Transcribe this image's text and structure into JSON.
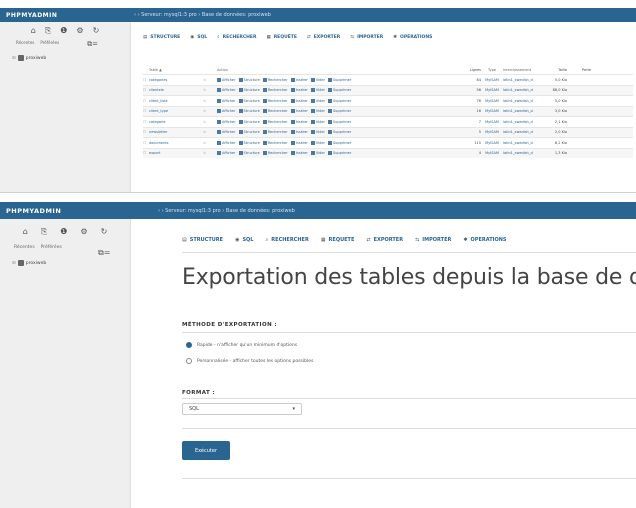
{
  "app": {
    "logo": "PHPMYADMIN"
  },
  "back": {
    "breadcrumb": "‹ › Serveur: mysql1:3 pro › Base de données: proxiweb",
    "nav_icons": [
      "home-icon",
      "logout-icon",
      "info-icon",
      "settings-icon",
      "reload-icon"
    ],
    "sidebar_links": [
      "Récentes",
      "Préférées"
    ],
    "tree_db": "proxiweb",
    "tabs": [
      "STRUCTURE",
      "SQL",
      "RECHERCHER",
      "REQUÊTE",
      "EXPORTER",
      "IMPORTER",
      "OPÉRATIONS"
    ],
    "table_headers": [
      "Table ▲",
      "Action",
      "Lignes",
      "Type",
      "Interclassement",
      "Taille",
      "Perte"
    ],
    "action_labels": [
      "Afficher",
      "Structure",
      "Rechercher",
      "Insérer",
      "Vider",
      "Supprimer"
    ],
    "rows": [
      {
        "name": "categories",
        "lines": "84",
        "type": "MyISAM",
        "coll": "latin1_swedish_ci",
        "size": "5,0 Kio"
      },
      {
        "name": "clientele",
        "lines": "56",
        "type": "MyISAM",
        "coll": "latin1_swedish_ci",
        "size": "88,0 Kio"
      },
      {
        "name": "client_liste",
        "lines": "76",
        "type": "MyISAM",
        "coll": "latin1_swedish_ci",
        "size": "5,0 Kio"
      },
      {
        "name": "client_type",
        "lines": "16",
        "type": "MyISAM",
        "coll": "latin1_swedish_ci",
        "size": "3,0 Kio"
      },
      {
        "name": "categorie",
        "lines": "7",
        "type": "MyISAM",
        "coll": "latin1_swedish_ci",
        "size": "2,1 Kio"
      },
      {
        "name": "newsletter",
        "lines": "5",
        "type": "MyISAM",
        "coll": "latin1_swedish_ci",
        "size": "2,0 Kio"
      },
      {
        "name": "documents",
        "lines": "115",
        "type": "MyISAM",
        "coll": "latin1_swedish_ci",
        "size": "8,2 Kio"
      },
      {
        "name": "export",
        "lines": "4",
        "type": "MyISAM",
        "coll": "latin1_swedish_ci",
        "size": "1,3 Kio"
      }
    ]
  },
  "front": {
    "breadcrumb": "‹ › Serveur: mysql1:3 pro › Base de données: proxiweb",
    "nav_icons": [
      "home-icon",
      "logout-icon",
      "info-icon",
      "settings-icon",
      "reload-icon"
    ],
    "sidebar_links": [
      "Récentes",
      "Préférées"
    ],
    "tree_db": "proxiweb",
    "tabs": [
      "STRUCTURE",
      "SQL",
      "RECHERCHER",
      "REQUÊTE",
      "EXPORTER",
      "IMPORTER",
      "OPÉRATIONS"
    ],
    "active_tab": "EXPORTER",
    "title": "Exportation des tables depuis la base de d",
    "method_heading": "MÉTHODE D'EXPORTATION :",
    "method_options": [
      "Rapide - n'afficher qu'un minimum d'options",
      "Personnalisée - afficher toutes les options possibles"
    ],
    "format_heading": "FORMAT :",
    "format_value": "SQL",
    "submit_label": "Exécuter"
  },
  "colors": {
    "brand": "#2a6592",
    "sidebar_bg": "#efefef"
  }
}
